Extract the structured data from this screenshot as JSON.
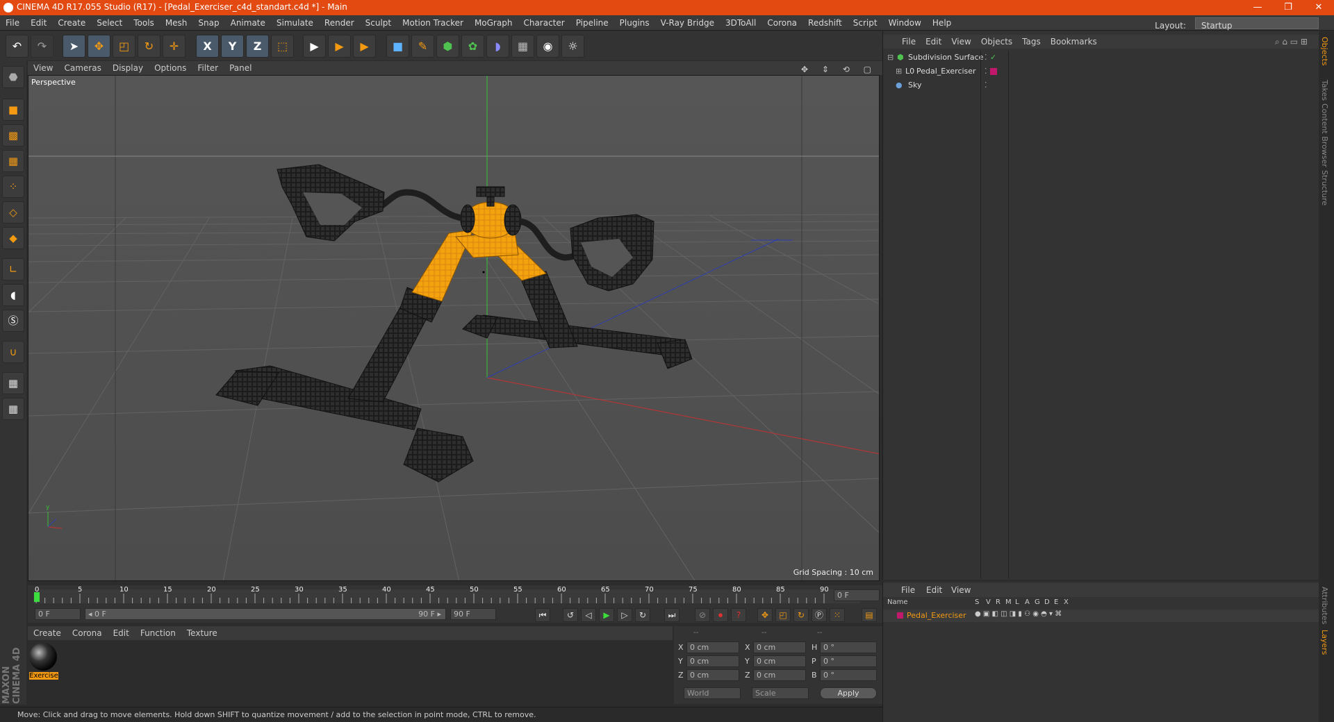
{
  "window": {
    "title": "CINEMA 4D R17.055 Studio (R17) - [Pedal_Exerciser_c4d_standart.c4d *] - Main",
    "controls": {
      "minimize": "—",
      "restore": "❐",
      "close": "✕"
    }
  },
  "menubar": {
    "items": [
      "File",
      "Edit",
      "Create",
      "Select",
      "Tools",
      "Mesh",
      "Snap",
      "Animate",
      "Simulate",
      "Render",
      "Sculpt",
      "Motion Tracker",
      "MoGraph",
      "Character",
      "Pipeline",
      "Plugins",
      "V-Ray Bridge",
      "3DToAll",
      "Corona",
      "Redshift",
      "Script",
      "Window",
      "Help"
    ],
    "layout_label": "Layout:",
    "layout_value": "Startup"
  },
  "toolbar": {
    "buttons": [
      {
        "name": "undo-button",
        "glyph": "↶"
      },
      {
        "name": "redo-button",
        "glyph": "↷"
      },
      {
        "name": "live-selection-button",
        "glyph": "➤"
      },
      {
        "name": "move-tool-button",
        "glyph": "✥"
      },
      {
        "name": "scale-tool-button",
        "glyph": "◰"
      },
      {
        "name": "rotate-tool-button",
        "glyph": "↻"
      },
      {
        "name": "transform-tool-button",
        "glyph": "✛"
      },
      {
        "name": "x-axis-button",
        "glyph": "X"
      },
      {
        "name": "y-axis-button",
        "glyph": "Y"
      },
      {
        "name": "z-axis-button",
        "glyph": "Z"
      },
      {
        "name": "coordinate-system-button",
        "glyph": "⬚"
      },
      {
        "name": "render-view-button",
        "glyph": "▶"
      },
      {
        "name": "render-picture-viewer-button",
        "glyph": "▶"
      },
      {
        "name": "edit-render-settings-button",
        "glyph": "▶"
      },
      {
        "name": "cube-button",
        "glyph": "■"
      },
      {
        "name": "pen-button",
        "glyph": "✎"
      },
      {
        "name": "subdivision-button",
        "glyph": "⬢"
      },
      {
        "name": "cloner-button",
        "glyph": "✿"
      },
      {
        "name": "deformer-button",
        "glyph": "◗"
      },
      {
        "name": "floor-button",
        "glyph": "▦"
      },
      {
        "name": "camera-button",
        "glyph": "◉"
      },
      {
        "name": "light-button",
        "glyph": "☼"
      }
    ]
  },
  "left_toolbar": {
    "buttons": [
      "make-editable",
      "model-mode",
      "texture-mode",
      "workplane-mode",
      "points-mode",
      "edges-mode",
      "polygons-mode",
      "enable-axis",
      "tweak-mode",
      "solo-mode",
      "snap-magnet",
      "enable-snap",
      "quantize"
    ]
  },
  "viewport": {
    "menu": [
      "View",
      "Cameras",
      "Display",
      "Options",
      "Filter",
      "Panel"
    ],
    "label": "Perspective",
    "grid_spacing": "Grid Spacing : 10 cm",
    "axis_y": "y"
  },
  "timeline": {
    "ticks": [
      "0",
      "5",
      "10",
      "15",
      "20",
      "25",
      "30",
      "35",
      "40",
      "45",
      "50",
      "55",
      "60",
      "65",
      "70",
      "75",
      "80",
      "85",
      "90"
    ],
    "current_frame": "0 F"
  },
  "transport": {
    "start_field": "0 F",
    "range_start": "◂ 0 F",
    "range_end": "90 F ▸",
    "end_field": "90 F"
  },
  "materials": {
    "menu": [
      "Create",
      "Corona",
      "Edit",
      "Function",
      "Texture"
    ],
    "items": [
      {
        "name": "Exercise"
      }
    ]
  },
  "coordinates": {
    "headers": [
      "--",
      "--",
      "--"
    ],
    "rows": [
      {
        "a": "X",
        "av": "0 cm",
        "b": "X",
        "bv": "0 cm",
        "c": "H",
        "cv": "0 °"
      },
      {
        "a": "Y",
        "av": "0 cm",
        "b": "Y",
        "bv": "0 cm",
        "c": "P",
        "cv": "0 °"
      },
      {
        "a": "Z",
        "av": "0 cm",
        "b": "Z",
        "bv": "0 cm",
        "c": "B",
        "cv": "0 °"
      }
    ],
    "space": "World",
    "mode": "Scale",
    "apply": "Apply"
  },
  "status": "Move: Click and drag to move elements. Hold down SHIFT to quantize movement / add to the selection in point mode, CTRL to remove.",
  "branding": "MAXON CINEMA 4D",
  "object_manager": {
    "menu": [
      "File",
      "Edit",
      "View",
      "Objects",
      "Tags",
      "Bookmarks"
    ],
    "objects": [
      {
        "name": "Subdivision Surface",
        "color": "#4fc24f"
      },
      {
        "name": "Pedal_Exerciser",
        "color": "#cccccc"
      },
      {
        "name": "Sky",
        "color": "#6a9fd8"
      }
    ]
  },
  "layer_manager": {
    "menu": [
      "File",
      "Edit",
      "View"
    ],
    "columns": [
      "Name",
      "S",
      "V",
      "R",
      "M",
      "L",
      "A",
      "G",
      "D",
      "E",
      "X"
    ],
    "layers": [
      {
        "name": "Pedal_Exerciser",
        "color": "#c0186a"
      }
    ]
  },
  "side_tabs": [
    "Objects",
    "Takes",
    "Content Browser",
    "Structure",
    "Attributes",
    "Layers"
  ],
  "colors": {
    "accent": "#f39a12",
    "titlebar": "#e24a12",
    "model": "#f5a20f"
  }
}
